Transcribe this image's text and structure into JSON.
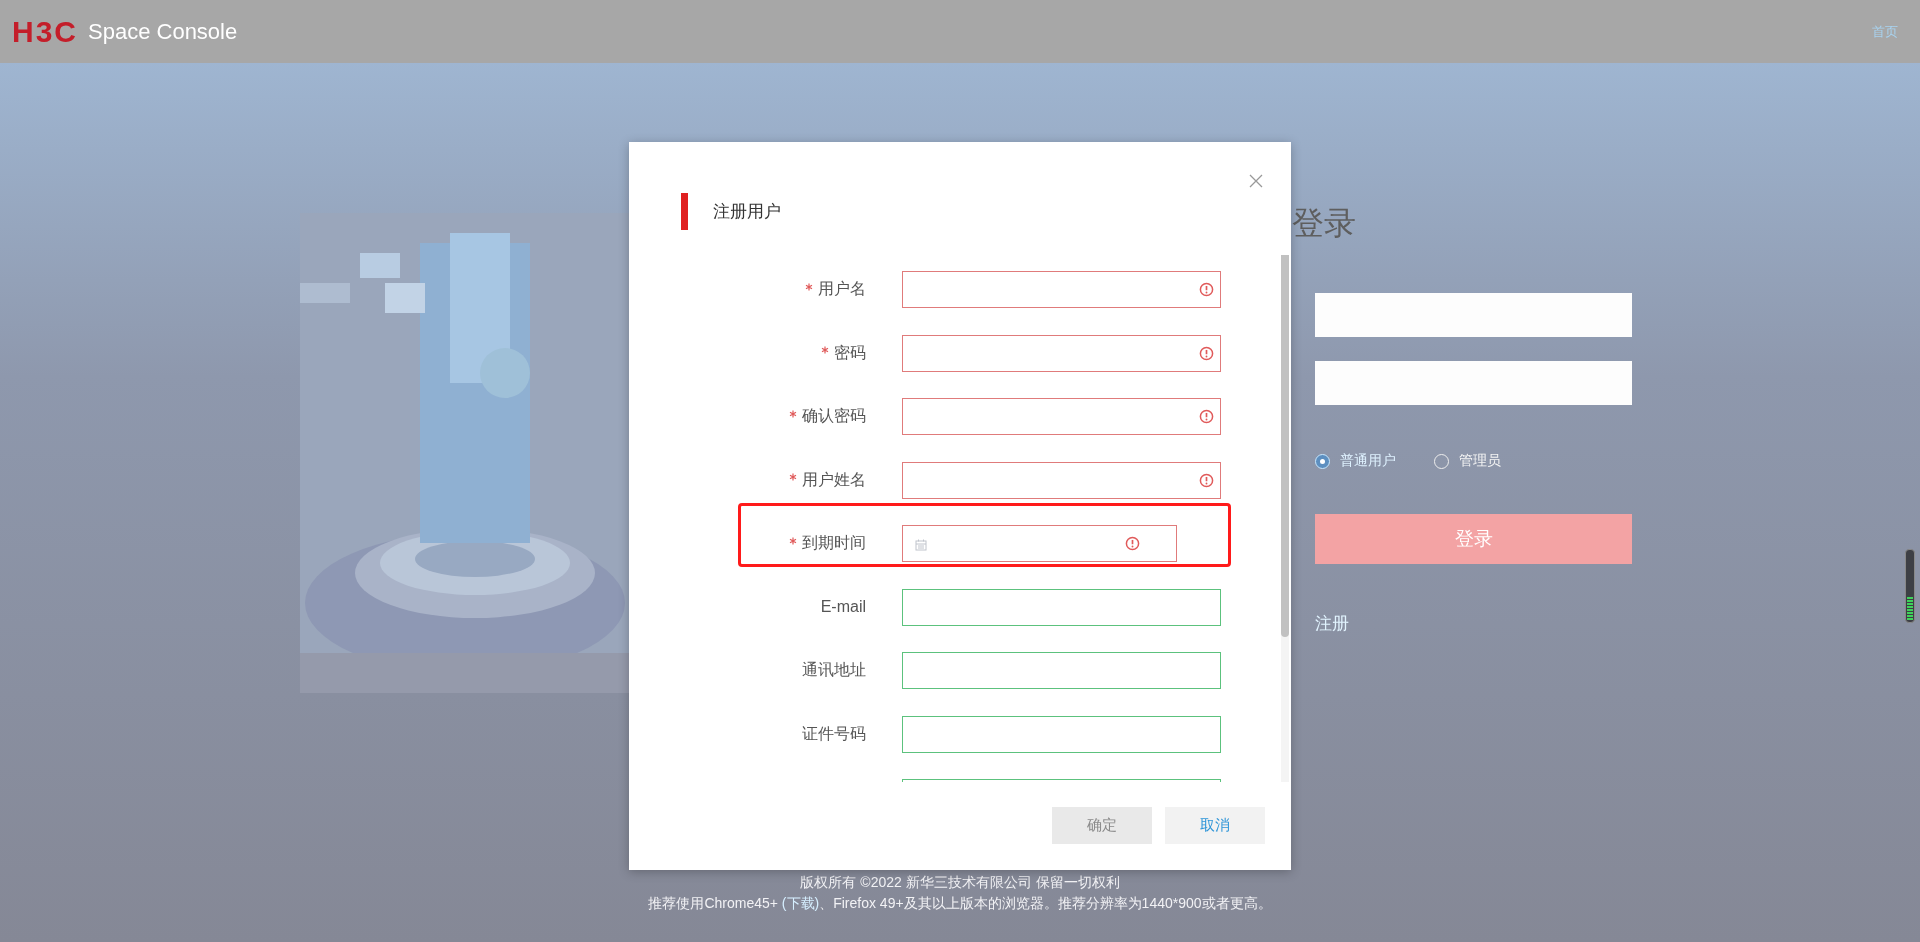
{
  "header": {
    "logo": "H3C",
    "product": "Space Console",
    "nav_link": "首页"
  },
  "login": {
    "title": "登录",
    "roles": [
      {
        "label": "普通用户",
        "selected": true
      },
      {
        "label": "管理员",
        "selected": false
      }
    ],
    "submit": "登录",
    "register_link": "注册"
  },
  "footer": {
    "copyright": "版权所有 ©2022 新华三技术有限公司 保留一切权利",
    "recommend_before": "推荐使用Chrome45+ ",
    "download_link": "(下载)",
    "recommend_after": "、Firefox 49+及其以上版本的浏览器。推荐分辨率为1440*900或者更高。"
  },
  "dialog": {
    "title": "注册用户",
    "fields": [
      {
        "label": "用户名",
        "kind": "text",
        "required": true,
        "invalid": true,
        "highlighted": false
      },
      {
        "label": "密码",
        "kind": "text",
        "required": true,
        "invalid": true,
        "highlighted": false
      },
      {
        "label": "确认密码",
        "kind": "text",
        "required": true,
        "invalid": true,
        "highlighted": false
      },
      {
        "label": "用户姓名",
        "kind": "text",
        "required": true,
        "invalid": true,
        "highlighted": false
      },
      {
        "label": "到期时间",
        "kind": "date",
        "required": true,
        "invalid": true,
        "highlighted": true
      },
      {
        "label": "E-mail",
        "kind": "text",
        "required": false,
        "invalid": false,
        "highlighted": false
      },
      {
        "label": "通讯地址",
        "kind": "text",
        "required": false,
        "invalid": false,
        "highlighted": false
      },
      {
        "label": "证件号码",
        "kind": "text",
        "required": false,
        "invalid": false,
        "highlighted": false
      },
      {
        "kind": "text",
        "required": false,
        "invalid": false,
        "highlighted": false
      }
    ],
    "buttons": [
      {
        "label": "确定",
        "disabled": true
      },
      {
        "label": "取消",
        "disabled": false
      }
    ]
  }
}
